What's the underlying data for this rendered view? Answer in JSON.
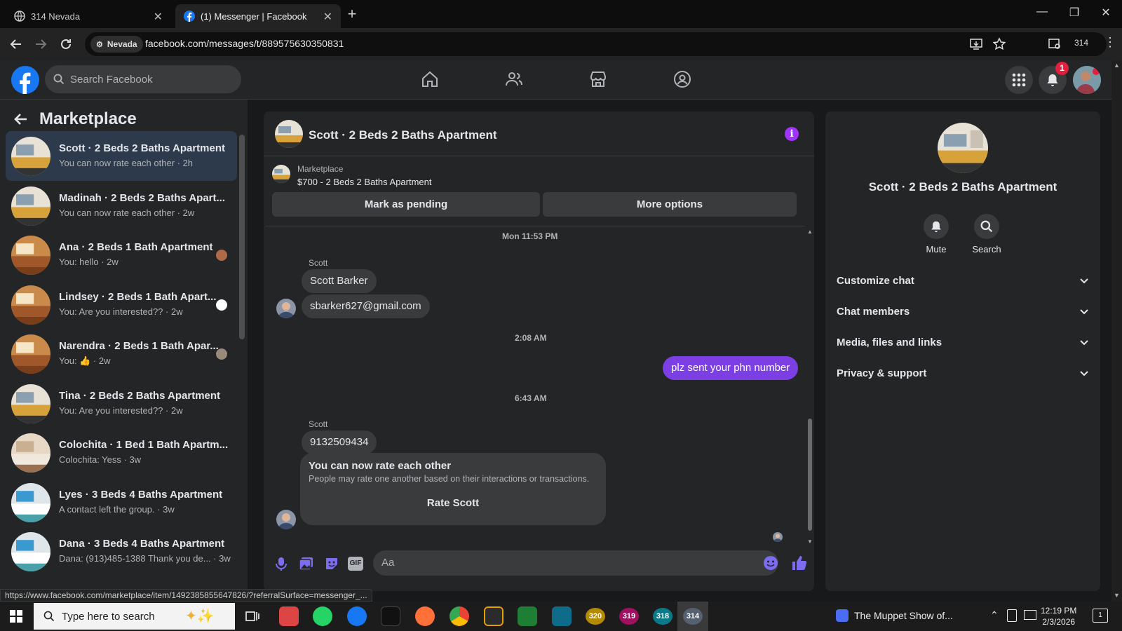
{
  "browser": {
    "tabs": [
      {
        "title": "314 Nevada"
      },
      {
        "title": "(1) Messenger | Facebook"
      }
    ],
    "profile_chip": "Nevada",
    "url": "facebook.com/messages/t/889575630350831",
    "profile_count": "314",
    "status_url": "https://www.facebook.com/marketplace/item/1492385855647826/?referralSurface=messenger_..."
  },
  "facebook": {
    "search_placeholder": "Search Facebook",
    "notification_count": "1"
  },
  "sidebar": {
    "title": "Marketplace",
    "conversations": [
      {
        "name": "Scott · 2 Beds 2 Baths Apartment",
        "preview": "You can now rate each other · 2h",
        "active": true
      },
      {
        "name": "Madinah · 2 Beds 2 Baths Apart...",
        "preview": "You can now rate each other · 2w"
      },
      {
        "name": "Ana · 2 Beds 1 Bath Apartment",
        "preview": "You: hello · 2w"
      },
      {
        "name": "Lindsey · 2 Beds 1 Bath Apart...",
        "preview": "You: Are you interested?? · 2w"
      },
      {
        "name": "Narendra · 2 Beds 1 Bath Apar...",
        "preview": "You: 👍 · 2w"
      },
      {
        "name": "Tina · 2 Beds 2 Baths Apartment",
        "preview": "You: Are you interested?? · 2w"
      },
      {
        "name": "Colochita · 1 Bed 1 Bath Apartm...",
        "preview": "Colochita: Yess · 3w"
      },
      {
        "name": "Lyes · 3 Beds 4 Baths Apartment",
        "preview": "A contact left the group. · 3w"
      },
      {
        "name": "Dana · 3 Beds 4 Baths Apartment",
        "preview": "Dana: (913)485-1388 Thank you de... · 3w"
      }
    ]
  },
  "chat": {
    "title": "Scott · 2 Beds 2 Baths Apartment",
    "listing_label": "Marketplace",
    "listing_price": "$700 - 2 Beds 2 Baths Apartment",
    "mark_pending": "Mark as pending",
    "more_options": "More options",
    "timestamp1": "Mon 11:53 PM",
    "sender1": "Scott",
    "msg1": "Scott Barker",
    "msg2": "sbarker627@gmail.com",
    "timestamp2": "2:08 AM",
    "my_msg": "plz sent your phn number",
    "timestamp3": "6:43 AM",
    "sender2": "Scott",
    "msg3": "9132509434",
    "rate_title": "You can now rate each other",
    "rate_desc": "People may rate one another based on their interactions or transactions.",
    "rate_button": "Rate Scott",
    "input_placeholder": "Aa"
  },
  "details": {
    "name": "Scott · 2 Beds 2 Baths Apartment",
    "mute": "Mute",
    "search": "Search",
    "sections": [
      "Customize chat",
      "Chat members",
      "Media, files and links",
      "Privacy & support"
    ]
  },
  "taskbar": {
    "search_placeholder": "Type here to search",
    "apps": [
      "320",
      "319",
      "318",
      "314"
    ],
    "media_title": "The Muppet Show of...",
    "time": "12:19 PM",
    "date": "2/3/2026",
    "notif_count": "1"
  },
  "colors": {
    "accent": "#7b3fe4",
    "fb_blue": "#1877f2",
    "panel": "#242526",
    "info": "#a033ff"
  }
}
